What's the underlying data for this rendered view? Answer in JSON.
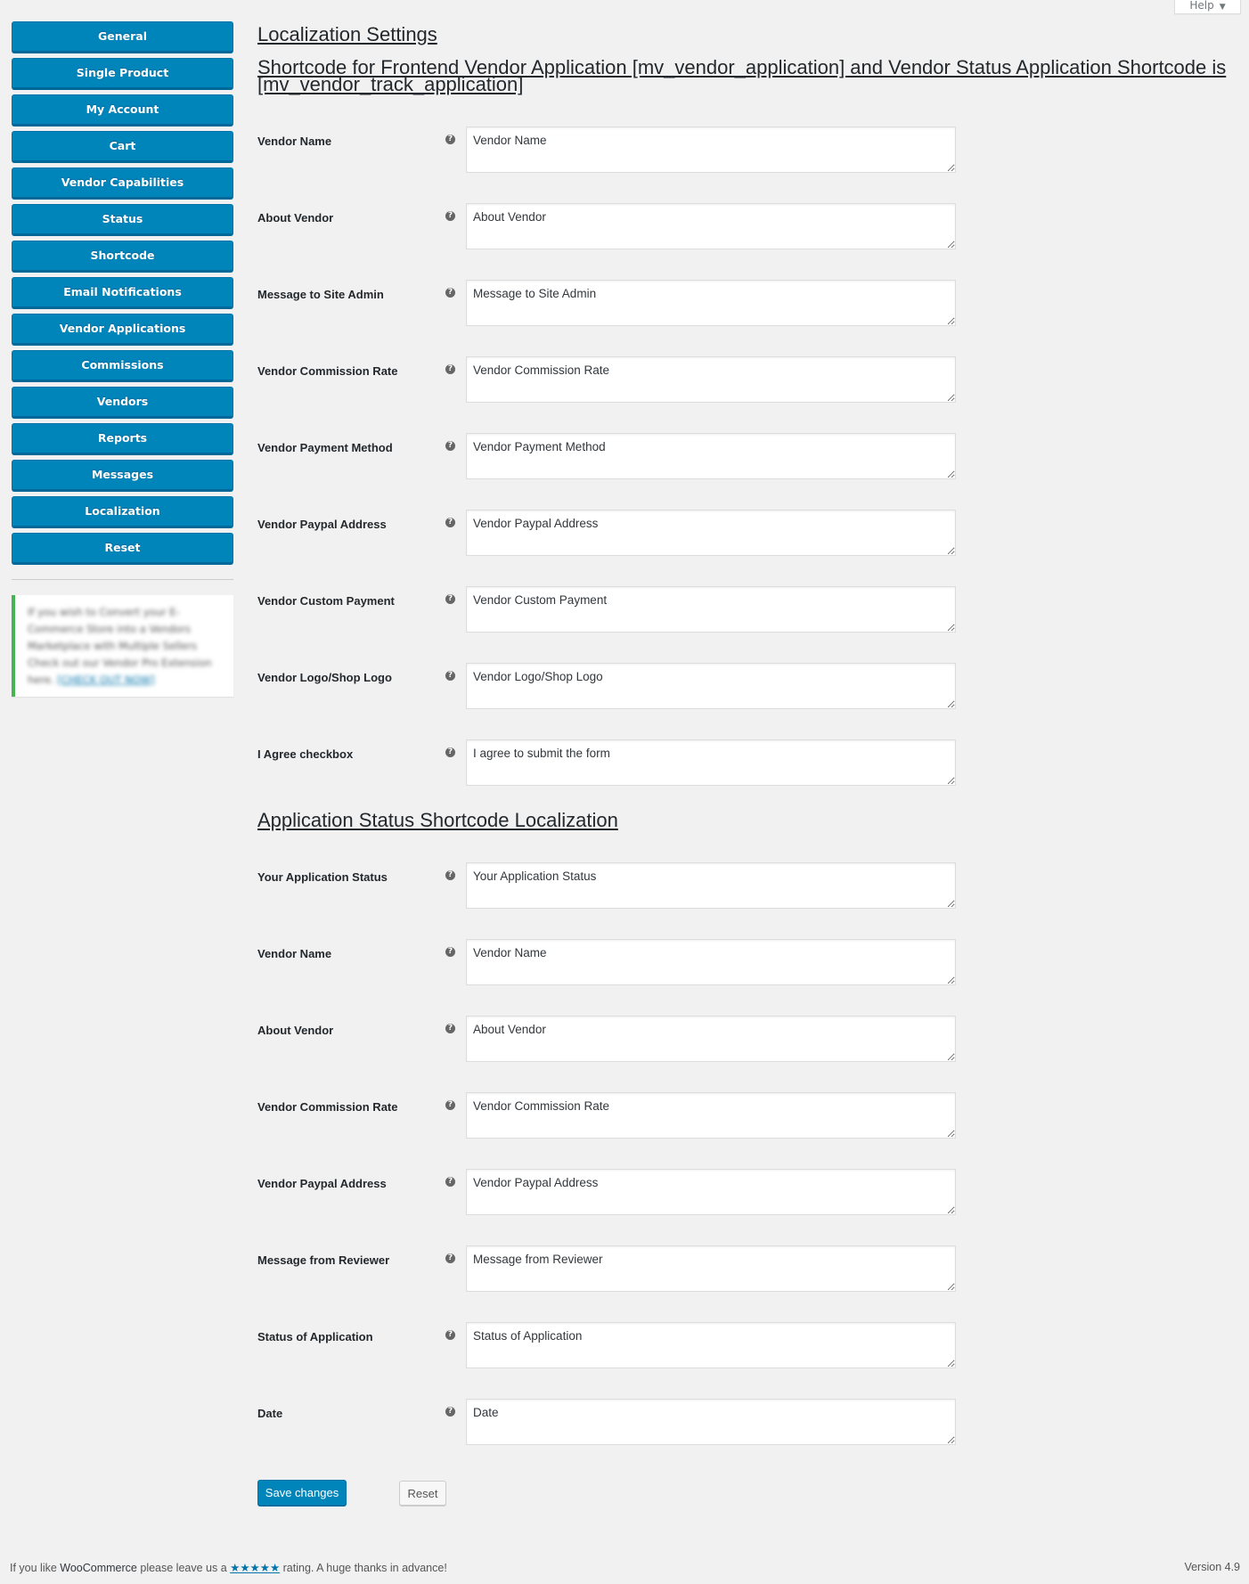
{
  "help_tab": {
    "label": "Help",
    "caret_icon": "triangle-down-icon"
  },
  "sidebar": {
    "items": [
      {
        "label": "General"
      },
      {
        "label": "Single Product"
      },
      {
        "label": "My Account"
      },
      {
        "label": "Cart"
      },
      {
        "label": "Vendor Capabilities"
      },
      {
        "label": "Status"
      },
      {
        "label": "Shortcode"
      },
      {
        "label": "Email Notifications"
      },
      {
        "label": "Vendor Applications"
      },
      {
        "label": "Commissions"
      },
      {
        "label": "Vendors"
      },
      {
        "label": "Reports"
      },
      {
        "label": "Messages"
      },
      {
        "label": "Localization"
      },
      {
        "label": "Reset"
      }
    ],
    "promo": {
      "text": "If you wish to Convert your E-Commerce Store into a Vendors Marketplace with Multiple Sellers Check out our Vendor Pro Extension here.",
      "link_label": "[CHECK OUT NOW]",
      "accent_color": "#46b450"
    }
  },
  "main": {
    "title": "Localization Settings",
    "subtitle": "Shortcode for Frontend Vendor Application [mv_vendor_application] and Vendor Status Application Shortcode is [mv_vendor_track_application]",
    "application_fields": [
      {
        "label": "Vendor Name",
        "value": "Vendor Name"
      },
      {
        "label": "About Vendor",
        "value": "About Vendor"
      },
      {
        "label": "Message to Site Admin",
        "value": "Message to Site Admin"
      },
      {
        "label": "Vendor Commission Rate",
        "value": "Vendor Commission Rate"
      },
      {
        "label": "Vendor Payment Method",
        "value": "Vendor Payment Method"
      },
      {
        "label": "Vendor Paypal Address",
        "value": "Vendor Paypal Address"
      },
      {
        "label": "Vendor Custom Payment",
        "value": "Vendor Custom Payment"
      },
      {
        "label": "Vendor Logo/Shop Logo",
        "value": "Vendor Logo/Shop Logo"
      },
      {
        "label": "I Agree checkbox",
        "value": "I agree to submit the form"
      }
    ],
    "status_section_title": "Application Status Shortcode Localization",
    "status_fields": [
      {
        "label": "Your Application Status",
        "value": "Your Application Status"
      },
      {
        "label": "Vendor Name",
        "value": "Vendor Name"
      },
      {
        "label": "About Vendor",
        "value": "About Vendor"
      },
      {
        "label": "Vendor Commission Rate",
        "value": "Vendor Commission Rate"
      },
      {
        "label": "Vendor Paypal Address",
        "value": "Vendor Paypal Address"
      },
      {
        "label": "Message from Reviewer",
        "value": "Message from Reviewer"
      },
      {
        "label": "Status of Application",
        "value": "Status of Application"
      },
      {
        "label": "Date",
        "value": "Date"
      }
    ],
    "help_icon_glyph": "?",
    "save_label": "Save changes",
    "reset_label": "Reset"
  },
  "footer": {
    "prefix": "If you like ",
    "brand": "WooCommerce",
    "middle": " please leave us a ",
    "stars": "★★★★★",
    "suffix": " rating. A huge thanks in advance!",
    "version": "Version 4.9"
  },
  "colors": {
    "primary": "#0085ba",
    "background": "#f1f1f1",
    "link": "#0073aa"
  }
}
